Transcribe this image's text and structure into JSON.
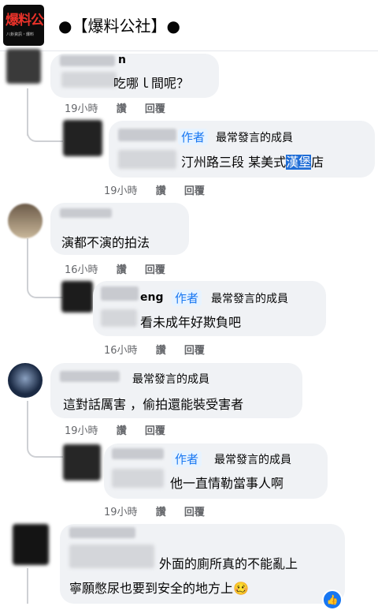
{
  "header": {
    "logo_text": "爆料公",
    "logo_sub": "八卦資訊・爆料",
    "title": "●【爆料公社】●"
  },
  "colors": {
    "author_blue": "#1877f2",
    "bubble_bg": "#f0f2f5",
    "meta_gray": "#65676b",
    "highlight": "#1f6dd6"
  },
  "badges": {
    "author": "作者",
    "member": "最常發言的成員"
  },
  "actions": {
    "like": "讚",
    "reply": "回覆"
  },
  "comments": [
    {
      "name_tail": "n",
      "text": "吃哪ｌ間呢？",
      "time": "19小時",
      "reply": {
        "text_before": "汀州路三段 某美式",
        "text_highlight": "漢堡",
        "text_after": "店",
        "time": "19小時"
      }
    },
    {
      "text": "演都不演的拍法",
      "time": "16小時",
      "reply": {
        "name_tail": "eng",
        "text": "看未成年好欺負吧",
        "time": "16小時"
      }
    },
    {
      "text": "這對話厲害 ，偷拍還能裝受害者",
      "time": "19小時",
      "reply": {
        "text": "他一直情勒當事人啊",
        "time": "19小時"
      }
    },
    {
      "line1": "外面的廁所真的不能亂上",
      "line2": "寧願憋尿也要到安全的地方上",
      "emoji": "🥴",
      "reaction_icon": "like-icon"
    }
  ]
}
